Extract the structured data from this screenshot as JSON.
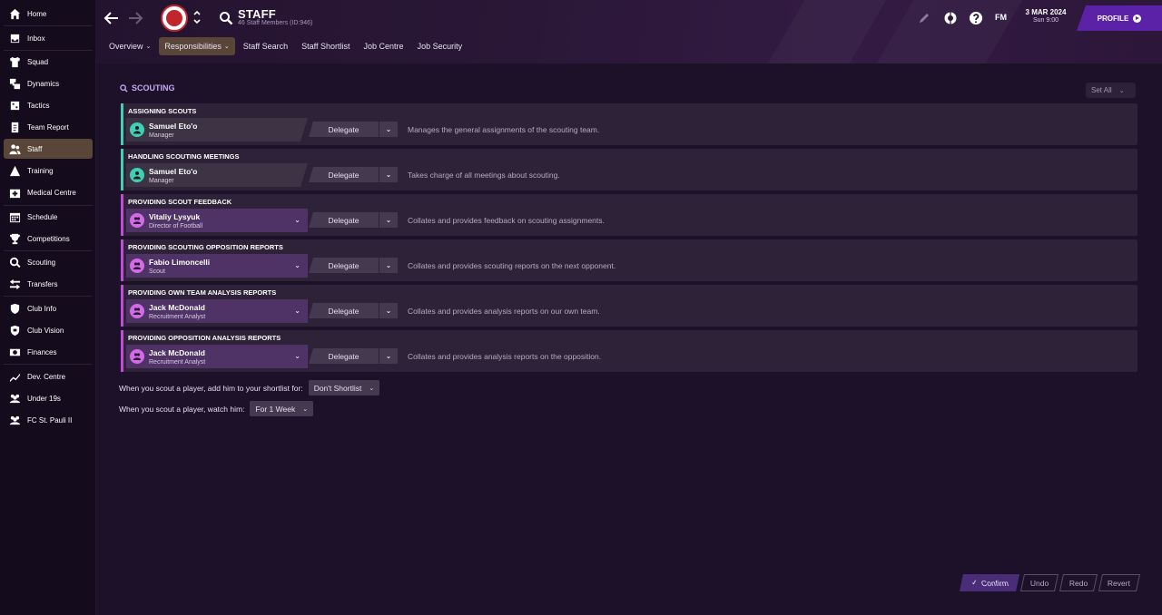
{
  "sidebar": {
    "items": [
      {
        "label": "Home",
        "icon": "home-icon"
      },
      {
        "label": "Inbox",
        "icon": "inbox-icon"
      },
      {
        "label": "Squad",
        "icon": "shirt-icon"
      },
      {
        "label": "Dynamics",
        "icon": "dynamics-icon"
      },
      {
        "label": "Tactics",
        "icon": "tactics-icon"
      },
      {
        "label": "Team Report",
        "icon": "report-icon"
      },
      {
        "label": "Staff",
        "icon": "staff-icon"
      },
      {
        "label": "Training",
        "icon": "training-icon"
      },
      {
        "label": "Medical Centre",
        "icon": "medical-icon"
      },
      {
        "label": "Schedule",
        "icon": "calendar-icon"
      },
      {
        "label": "Competitions",
        "icon": "trophy-icon"
      },
      {
        "label": "Scouting",
        "icon": "search-icon"
      },
      {
        "label": "Transfers",
        "icon": "transfer-icon"
      },
      {
        "label": "Club Info",
        "icon": "shield-icon"
      },
      {
        "label": "Club Vision",
        "icon": "vision-icon"
      },
      {
        "label": "Finances",
        "icon": "finance-icon"
      },
      {
        "label": "Dev. Centre",
        "icon": "dev-icon"
      },
      {
        "label": "Under 19s",
        "icon": "group-icon"
      },
      {
        "label": "FC St. Pauli II",
        "icon": "group-icon"
      }
    ]
  },
  "header": {
    "title": "STAFF",
    "subtitle": "46 Staff Members (ID:946)",
    "tabs": [
      "Overview",
      "Responsibilities",
      "Staff Search",
      "Staff Shortlist",
      "Job Centre",
      "Job Security"
    ],
    "fm_label": "FM",
    "date": "3 MAR 2024",
    "day_time": "Sun 9:00",
    "profile": "PROFILE"
  },
  "main": {
    "section_title": "SCOUTING",
    "set_all": "Set All",
    "delegate_label": "Delegate",
    "rows": [
      {
        "title": "ASSIGNING SCOUTS",
        "name": "Samuel Eto'o",
        "role": "Manager",
        "desc": "Manages the general assignments of the scouting team."
      },
      {
        "title": "HANDLING SCOUTING MEETINGS",
        "name": "Samuel Eto'o",
        "role": "Manager",
        "desc": "Takes charge of all meetings about scouting."
      },
      {
        "title": "PROVIDING SCOUT FEEDBACK",
        "name": "Vitaliy Lysyuk",
        "role": "Director of Football",
        "desc": "Collates and provides feedback on scouting assignments."
      },
      {
        "title": "PROVIDING SCOUTING OPPOSITION REPORTS",
        "name": "Fabio Limoncelli",
        "role": "Scout",
        "desc": "Collates and provides scouting reports on the next opponent."
      },
      {
        "title": "PROVIDING OWN TEAM ANALYSIS REPORTS",
        "name": "Jack McDonald",
        "role": "Recruitment Analyst",
        "desc": "Collates and provides analysis reports on our own team."
      },
      {
        "title": "PROVIDING OPPOSITION ANALYSIS REPORTS",
        "name": "Jack McDonald",
        "role": "Recruitment Analyst",
        "desc": "Collates and provides analysis reports on the opposition."
      }
    ],
    "shortlist_label": "When you scout a player, add him to your shortlist for:",
    "shortlist_value": "Don't Shortlist",
    "watch_label": "When you scout a player, watch him:",
    "watch_value": "For 1 Week"
  },
  "footer": {
    "confirm": "Confirm",
    "undo": "Undo",
    "redo": "Redo",
    "revert": "Revert"
  },
  "colors": {
    "manager_accent": "#3ecfb4",
    "staff_accent": "#c04bd8",
    "active_nav": "#5a4638",
    "profile_button": "#5b22a8"
  }
}
